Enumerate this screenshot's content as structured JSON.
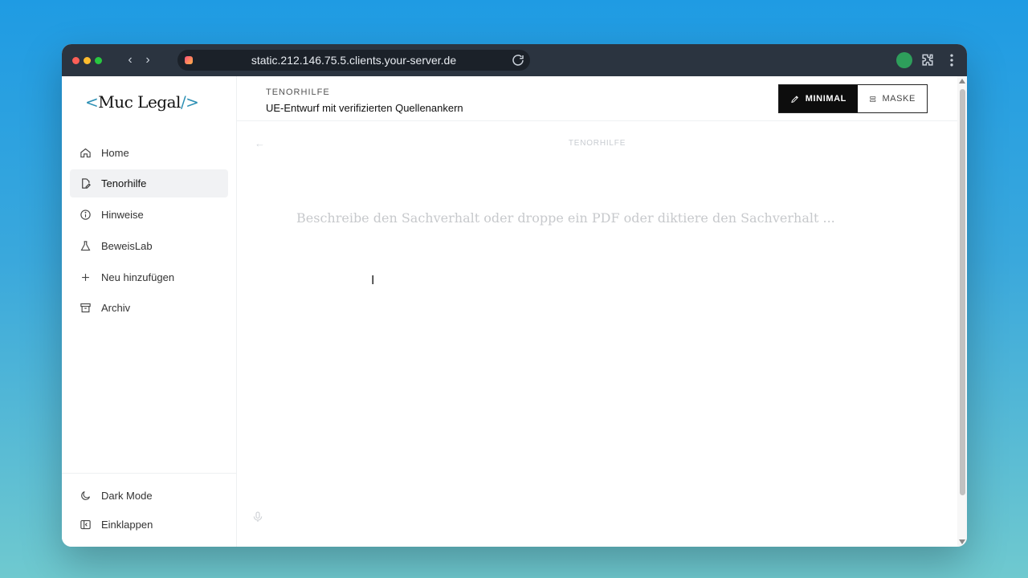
{
  "browser": {
    "url": "static.212.146.75.5.clients.your-server.de"
  },
  "sidebar": {
    "logo_left": "<",
    "logo_text": "Muc Legal",
    "logo_right": "/>",
    "items": [
      {
        "label": "Home",
        "icon": "home-icon"
      },
      {
        "label": "Tenorhilfe",
        "icon": "document-edit-icon"
      },
      {
        "label": "Hinweise",
        "icon": "info-icon"
      },
      {
        "label": "BeweisLab",
        "icon": "flask-icon"
      },
      {
        "label": "Neu hinzufügen",
        "icon": "plus-icon"
      },
      {
        "label": "Archiv",
        "icon": "archive-icon"
      }
    ],
    "active_item": "Tenorhilfe",
    "footer": [
      {
        "label": "Dark Mode",
        "icon": "moon-icon"
      },
      {
        "label": "Einklappen",
        "icon": "collapse-sidebar-icon"
      }
    ]
  },
  "header": {
    "eyebrow": "TENORHILFE",
    "subtitle": "UE-Entwurf mit verifizierten Quellenankern",
    "modes": [
      {
        "label": "MINIMAL",
        "active": true
      },
      {
        "label": "MASKE",
        "active": false
      }
    ]
  },
  "main": {
    "center_label": "TENORHILFE",
    "input_placeholder": "Beschreibe den Sachverhalt oder droppe ein PDF oder diktiere den Sachverhalt ..."
  },
  "colors": {
    "accent": "#2b8fb4",
    "dark": "#0d0d0d",
    "titlebar": "#2b3440"
  }
}
